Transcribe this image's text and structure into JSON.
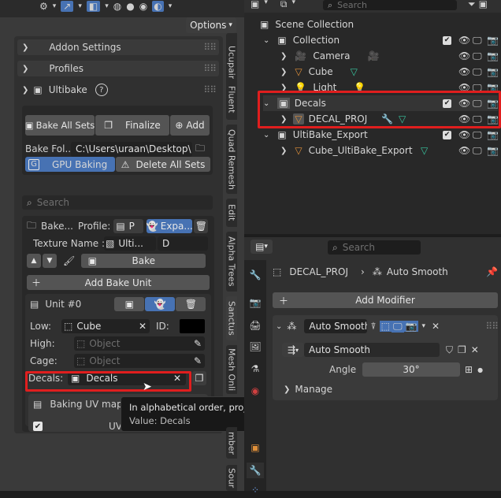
{
  "header_left": {
    "options_label": "Options"
  },
  "search": {
    "placeholder": "Search"
  },
  "panels": {
    "addon_settings": "Addon Settings",
    "profiles": "Profiles",
    "ultibake": "Ultibake"
  },
  "sets": {
    "bake_all": "Bake All Sets",
    "finalize": "Finalize",
    "add": "Add"
  },
  "bake_folder": {
    "label": "Bake Fol...",
    "value": "C:\\Users\\uraan\\Desktop\\"
  },
  "gpu": {
    "gpu_label": "GPU Baking",
    "delete_label": "Delete All Sets",
    "g_letter": "G"
  },
  "bake_set": {
    "bake_short": "Bake...",
    "profile_label": "Profile:",
    "profile_value": "P",
    "expand_label": "Expa..."
  },
  "texture": {
    "label": "Texture Name :",
    "value": "Ulti...",
    "suffix": "D"
  },
  "bake_button": "Bake",
  "add_bake_unit": "Add Bake Unit",
  "unit": {
    "title": "Unit #0",
    "low_label": "Low:",
    "low_value": "Cube",
    "id_label": "ID:",
    "high_label": "High:",
    "high_placeholder": "Object",
    "cage_label": "Cage:",
    "cage_placeholder": "Object",
    "decals_label": "Decals:",
    "decals_value": "Decals"
  },
  "baking_uv_map": "Baking UV map",
  "uv_label": "UV",
  "tooltip": {
    "text": "In alphabetical order, project the meshes to the low object..",
    "value": "Value: Decals"
  },
  "side_tabs": [
    "Ucupaint",
    "Fluent",
    "Quad Remesh",
    "Edit",
    "Alpha Trees",
    "Sanctus",
    "Mesh Onli",
    "mber",
    "Sour"
  ],
  "outliner": {
    "search_placeholder": "Search",
    "items": [
      {
        "label": "Scene Collection"
      },
      {
        "label": "Collection"
      },
      {
        "label": "Camera"
      },
      {
        "label": "Cube"
      },
      {
        "label": "Light"
      },
      {
        "label": "Decals"
      },
      {
        "label": "DECAL_PROJ"
      },
      {
        "label": "UltiBake_Export"
      },
      {
        "label": "Cube_UltiBake_Export"
      }
    ]
  },
  "properties": {
    "search_placeholder": "Search",
    "breadcrumb_object": "DECAL_PROJ",
    "breadcrumb_modifier": "Auto Smooth",
    "add_modifier": "Add Modifier",
    "modifier_name": "Auto Smooth",
    "nodegroup_name": "Auto Smooth",
    "angle_label": "Angle",
    "angle_value": "30°",
    "manage_label": "Manage"
  },
  "colors": {
    "accent_blue": "#4772b3",
    "highlight_red": "#e01e1e"
  }
}
